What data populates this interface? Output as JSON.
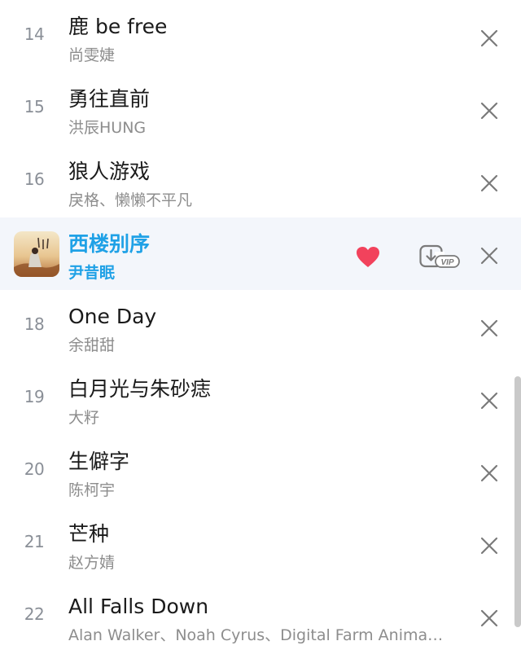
{
  "rows": [
    {
      "num": "14",
      "title": "鹿 be free",
      "artist": "尚雯婕"
    },
    {
      "num": "15",
      "title": "勇往直前",
      "artist": "洪辰HUNG"
    },
    {
      "num": "16",
      "title": "狼人游戏",
      "artist": "戾格、懒懒不平凡"
    },
    {
      "num": "",
      "title": "西楼别序",
      "artist": "尹昔眠",
      "playing": true,
      "liked": true,
      "download_badge": "VIP"
    },
    {
      "num": "18",
      "title": "One Day",
      "artist": "余甜甜"
    },
    {
      "num": "19",
      "title": "白月光与朱砂痣",
      "artist": "大籽"
    },
    {
      "num": "20",
      "title": "生僻字",
      "artist": "陈柯宇"
    },
    {
      "num": "21",
      "title": "芒种",
      "artist": "赵方婧"
    },
    {
      "num": "22",
      "title": "All Falls Down",
      "artist": "Alan Walker、Noah Cyrus、Digital Farm Anima…"
    }
  ],
  "colors": {
    "playing_accent": "#1fa1e6",
    "heart": "#f2425c",
    "remove_icon": "#7a7a7a",
    "number": "#8a8f97"
  },
  "icons": {
    "remove": "close-icon",
    "like": "heart-icon",
    "download": "download-vip-icon"
  }
}
